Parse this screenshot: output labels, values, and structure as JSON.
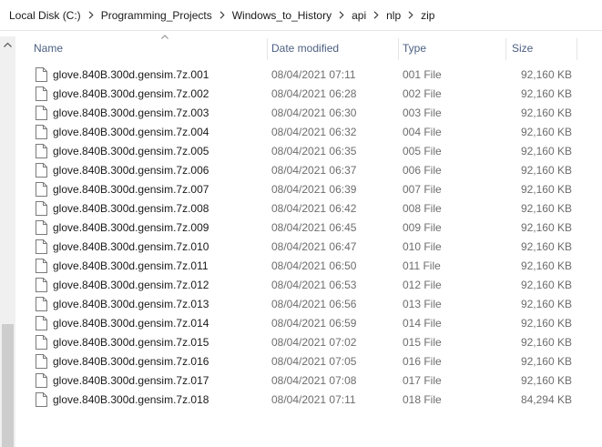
{
  "breadcrumb": [
    "Local Disk (C:)",
    "Programming_Projects",
    "Windows_to_History",
    "api",
    "nlp",
    "zip"
  ],
  "columns": {
    "name": "Name",
    "date": "Date modified",
    "type": "Type",
    "size": "Size"
  },
  "sort": {
    "column": "name",
    "direction": "ascending"
  },
  "files": [
    {
      "name": "glove.840B.300d.gensim.7z.001",
      "date": "08/04/2021 07:11",
      "type": "001 File",
      "size": "92,160 KB"
    },
    {
      "name": "glove.840B.300d.gensim.7z.002",
      "date": "08/04/2021 06:28",
      "type": "002 File",
      "size": "92,160 KB"
    },
    {
      "name": "glove.840B.300d.gensim.7z.003",
      "date": "08/04/2021 06:30",
      "type": "003 File",
      "size": "92,160 KB"
    },
    {
      "name": "glove.840B.300d.gensim.7z.004",
      "date": "08/04/2021 06:32",
      "type": "004 File",
      "size": "92,160 KB"
    },
    {
      "name": "glove.840B.300d.gensim.7z.005",
      "date": "08/04/2021 06:35",
      "type": "005 File",
      "size": "92,160 KB"
    },
    {
      "name": "glove.840B.300d.gensim.7z.006",
      "date": "08/04/2021 06:37",
      "type": "006 File",
      "size": "92,160 KB"
    },
    {
      "name": "glove.840B.300d.gensim.7z.007",
      "date": "08/04/2021 06:39",
      "type": "007 File",
      "size": "92,160 KB"
    },
    {
      "name": "glove.840B.300d.gensim.7z.008",
      "date": "08/04/2021 06:42",
      "type": "008 File",
      "size": "92,160 KB"
    },
    {
      "name": "glove.840B.300d.gensim.7z.009",
      "date": "08/04/2021 06:45",
      "type": "009 File",
      "size": "92,160 KB"
    },
    {
      "name": "glove.840B.300d.gensim.7z.010",
      "date": "08/04/2021 06:47",
      "type": "010 File",
      "size": "92,160 KB"
    },
    {
      "name": "glove.840B.300d.gensim.7z.011",
      "date": "08/04/2021 06:50",
      "type": "011 File",
      "size": "92,160 KB"
    },
    {
      "name": "glove.840B.300d.gensim.7z.012",
      "date": "08/04/2021 06:53",
      "type": "012 File",
      "size": "92,160 KB"
    },
    {
      "name": "glove.840B.300d.gensim.7z.013",
      "date": "08/04/2021 06:56",
      "type": "013 File",
      "size": "92,160 KB"
    },
    {
      "name": "glove.840B.300d.gensim.7z.014",
      "date": "08/04/2021 06:59",
      "type": "014 File",
      "size": "92,160 KB"
    },
    {
      "name": "glove.840B.300d.gensim.7z.015",
      "date": "08/04/2021 07:02",
      "type": "015 File",
      "size": "92,160 KB"
    },
    {
      "name": "glove.840B.300d.gensim.7z.016",
      "date": "08/04/2021 07:05",
      "type": "016 File",
      "size": "92,160 KB"
    },
    {
      "name": "glove.840B.300d.gensim.7z.017",
      "date": "08/04/2021 07:08",
      "type": "017 File",
      "size": "92,160 KB"
    },
    {
      "name": "glove.840B.300d.gensim.7z.018",
      "date": "08/04/2021 07:11",
      "type": "018 File",
      "size": "84,294 KB"
    }
  ],
  "colors": {
    "header_text": "#4d6082",
    "secondary_text": "#6d6d6d",
    "scrollbar_track": "#f0f0f0",
    "scrollbar_thumb": "#cdcdcd"
  },
  "icons": {
    "breadcrumb_separator": "chevron-right-icon",
    "sort_indicator": "sort-ascending-icon",
    "file": "generic-file-icon",
    "scroll_up": "scroll-up-arrow-icon"
  }
}
